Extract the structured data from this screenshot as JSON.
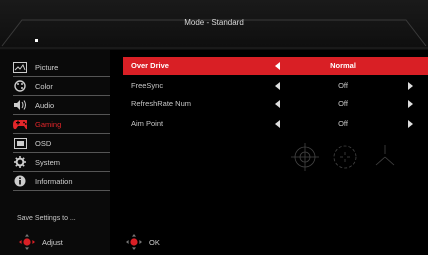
{
  "header": {
    "title": "Mode - Standard"
  },
  "sidebar": {
    "items": [
      {
        "label": "Picture",
        "icon": "picture-icon",
        "active": false
      },
      {
        "label": "Color",
        "icon": "color-palette-icon",
        "active": false
      },
      {
        "label": "Audio",
        "icon": "speaker-icon",
        "active": false
      },
      {
        "label": "Gaming",
        "icon": "gamepad-icon",
        "active": true
      },
      {
        "label": "OSD",
        "icon": "osd-screen-icon",
        "active": false
      },
      {
        "label": "System",
        "icon": "gear-icon",
        "active": false
      },
      {
        "label": "Information",
        "icon": "info-icon",
        "active": false
      }
    ],
    "save_label": "Save Settings to ..."
  },
  "settings": [
    {
      "name": "Over Drive",
      "value": "Normal",
      "selected": true
    },
    {
      "name": "FreeSync",
      "value": "Off",
      "selected": false
    },
    {
      "name": "RefreshRate Num",
      "value": "Off",
      "selected": false
    },
    {
      "name": "Aim Point",
      "value": "Off",
      "selected": false
    }
  ],
  "footer": {
    "adjust_label": "Adjust",
    "ok_label": "OK"
  },
  "colors": {
    "accent": "#d91f25",
    "background": "#000000"
  }
}
